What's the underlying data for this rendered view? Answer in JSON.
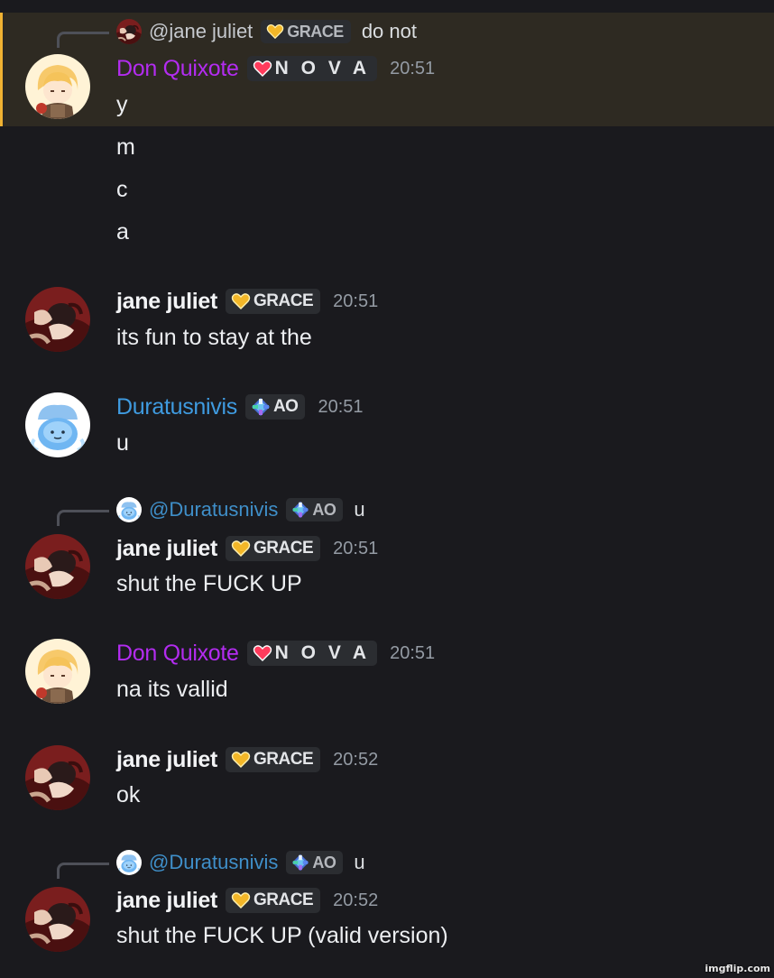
{
  "users": {
    "don": {
      "name": "Don Quixote",
      "tag": "N O V A"
    },
    "jane": {
      "name": "jane juliet",
      "tag": "GRACE"
    },
    "dura": {
      "name": "Duratusnivis",
      "tag": "AO"
    }
  },
  "colors": {
    "background": "#1a1a1e",
    "highlight_bg": "#2e2a22",
    "highlight_bar": "#f0b232",
    "purple_name": "#b32cf0",
    "blue_name": "#3f9be0",
    "timestamp": "#949ba4"
  },
  "icons": {
    "nova_tag": "heart-icon",
    "grace_tag": "gold-heart-icon",
    "ao_tag": "diamond-icon"
  },
  "messages": [
    {
      "reply": {
        "name": "@jane juliet",
        "tag": "GRACE",
        "text": "do not"
      },
      "author": "Don Quixote",
      "tag": "N O V A",
      "time": "20:51",
      "lines": [
        "y",
        "m",
        "c",
        "a"
      ]
    },
    {
      "author": "jane juliet",
      "tag": "GRACE",
      "time": "20:51",
      "lines": [
        "its fun to stay at the"
      ]
    },
    {
      "author": "Duratusnivis",
      "tag": "AO",
      "time": "20:51",
      "lines": [
        "u"
      ]
    },
    {
      "reply": {
        "name": "@Duratusnivis",
        "tag": "AO",
        "text": "u"
      },
      "author": "jane juliet",
      "tag": "GRACE",
      "time": "20:51",
      "lines": [
        "shut the FUCK UP"
      ]
    },
    {
      "author": "Don Quixote",
      "tag": "N O V A",
      "time": "20:51",
      "lines": [
        "na its vallid"
      ]
    },
    {
      "author": "jane juliet",
      "tag": "GRACE",
      "time": "20:52",
      "lines": [
        "ok"
      ]
    },
    {
      "reply": {
        "name": "@Duratusnivis",
        "tag": "AO",
        "text": "u"
      },
      "author": "jane juliet",
      "tag": "GRACE",
      "time": "20:52",
      "lines": [
        "shut the FUCK UP (valid version)"
      ]
    }
  ],
  "watermark": "imgflip.com"
}
